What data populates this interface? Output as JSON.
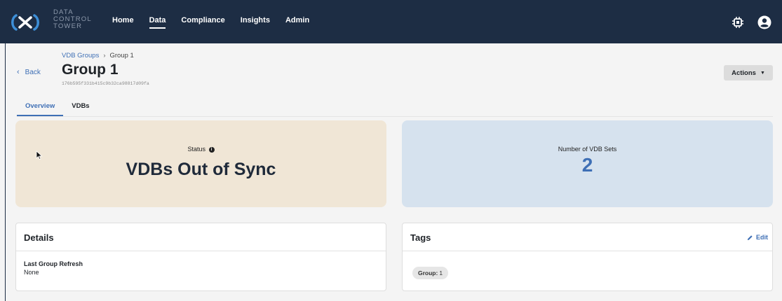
{
  "app": {
    "logo_lines": [
      "DATA",
      "CONTROL",
      "TOWER"
    ],
    "brand_colors": {
      "nav_bg": "#1d2d44",
      "accent": "#3e6fb5"
    }
  },
  "nav": {
    "items": [
      {
        "label": "Home",
        "active": false
      },
      {
        "label": "Data",
        "active": true
      },
      {
        "label": "Compliance",
        "active": false
      },
      {
        "label": "Insights",
        "active": false
      },
      {
        "label": "Admin",
        "active": false
      }
    ],
    "icons": [
      "chip-icon",
      "user-icon"
    ]
  },
  "breadcrumb": {
    "parent": "VDB Groups",
    "separator": "›",
    "current": "Group 1"
  },
  "back": {
    "label": "Back"
  },
  "page": {
    "title": "Group 1",
    "id": "176b595f331b415c9b32ca98817d09fa"
  },
  "actions": {
    "label": "Actions"
  },
  "tabs": [
    {
      "label": "Overview",
      "active": true
    },
    {
      "label": "VDBs",
      "active": false
    }
  ],
  "status_card": {
    "label": "Status",
    "value": "VDBs Out of Sync",
    "color": "#f0e6d6"
  },
  "sets_card": {
    "label": "Number of VDB Sets",
    "value": "2",
    "color": "#d6e2ee"
  },
  "details": {
    "title": "Details",
    "fields": [
      {
        "label": "Last Group Refresh",
        "value": "None"
      }
    ]
  },
  "tags": {
    "title": "Tags",
    "edit_label": "Edit",
    "items": [
      {
        "key": "Group:",
        "value": "1"
      }
    ]
  }
}
